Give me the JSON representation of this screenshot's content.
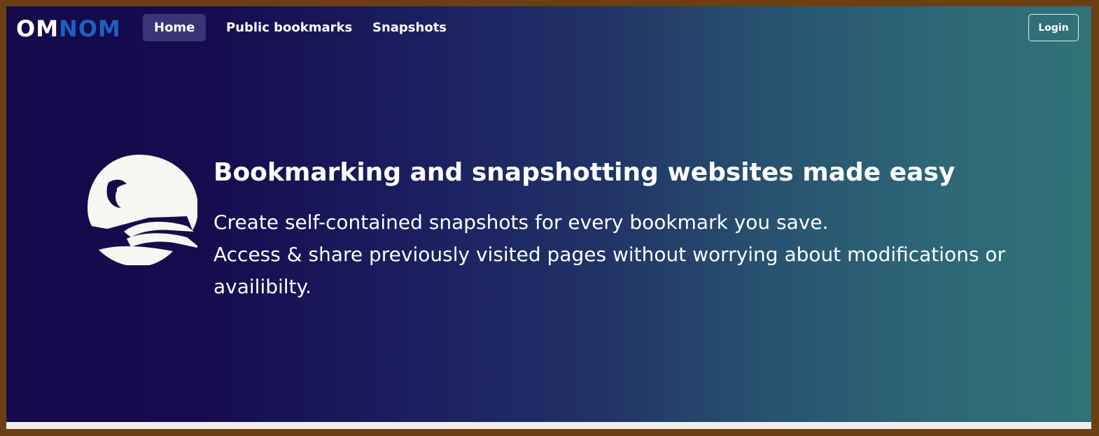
{
  "brand": {
    "logo_part1": "OM",
    "logo_part2": "NOM"
  },
  "nav": {
    "home": "Home",
    "public_bookmarks": "Public bookmarks",
    "snapshots": "Snapshots",
    "active": "Home"
  },
  "header": {
    "login_label": "Login"
  },
  "hero": {
    "headline": "Bookmarking and snapshotting websites made easy",
    "line1": "Create self-contained snapshots for every bookmark you save.",
    "line2": "Access & share previously visited pages without worrying about modifications or",
    "line3": "availibilty.",
    "mascot_icon": "omnom-fish-mascot-icon"
  },
  "colors": {
    "gradient_start": "#140a4b",
    "gradient_end": "#317379",
    "logo_accent": "#1f5fbf",
    "active_nav_bg": "#3b3577",
    "text": "#ffffff"
  }
}
